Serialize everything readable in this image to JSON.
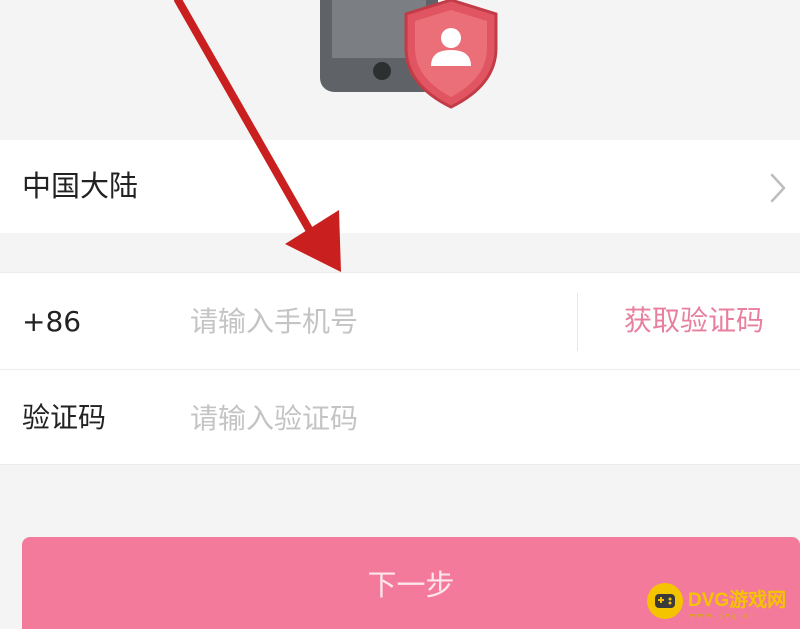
{
  "region": {
    "label": "中国大陆"
  },
  "phone": {
    "country_code": "+86",
    "placeholder": "请输入手机号",
    "get_code_label": "获取验证码"
  },
  "code": {
    "label": "验证码",
    "placeholder": "请输入验证码"
  },
  "next_button": {
    "label": "下一步"
  },
  "watermark": {
    "text": "DVG游戏网",
    "subtext": "www.dvg.cn"
  },
  "colors": {
    "background": "#f4f4f4",
    "accent_pink": "#f47a9b",
    "link_pink": "#e97f9f",
    "shield_red": "#e05561",
    "phone_gray": "#5f6266",
    "annotation_arrow": "#c91f1f"
  },
  "icons": [
    "phone-shield-illustration",
    "chevron-right-icon",
    "annotation-arrow",
    "dvg-logo-icon"
  ]
}
